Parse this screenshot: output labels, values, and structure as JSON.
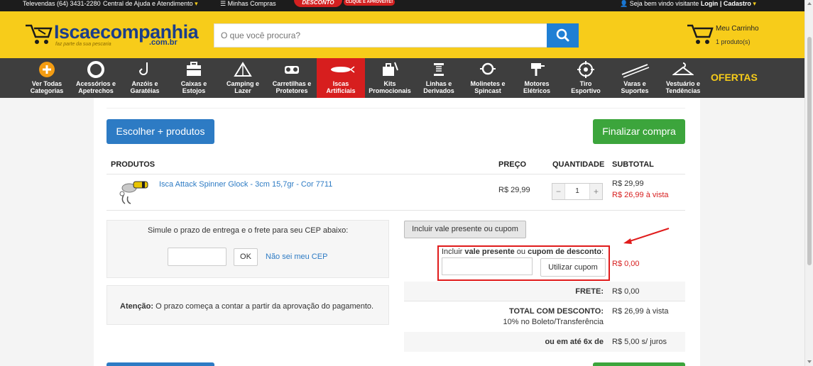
{
  "topbar": {
    "phone": "Televendas (64) 3431-2280",
    "help": "Central de Ajuda e Atendimento",
    "purchases": "Minhas Compras",
    "promo_discount": "DESCONTO",
    "promo_cta": "CLIQUE E APROVEITE!",
    "welcome": "Seja bem vindo visitante",
    "login": "Login",
    "separator": "|",
    "register": "Cadastro"
  },
  "header": {
    "logo_name": "Iscaecompanhia",
    "logo_domain": ".com.br",
    "logo_slogan": "faz parte da sua pescaria",
    "search_placeholder": "O que você procura?",
    "cart_title": "Meu Carrinho",
    "cart_count": "1 produto(s)"
  },
  "nav": {
    "items": [
      {
        "line1": "Ver Todas",
        "line2": "Categorias",
        "icon": "plus-circle-icon"
      },
      {
        "line1": "Acessórios e",
        "line2": "Apetrechos",
        "icon": "lifebuoy-icon"
      },
      {
        "line1": "Anzóis e",
        "line2": "Garatéias",
        "icon": "hook-icon"
      },
      {
        "line1": "Caixas e",
        "line2": "Estojos",
        "icon": "tackle-box-icon"
      },
      {
        "line1": "Camping e",
        "line2": "Lazer",
        "icon": "tent-icon"
      },
      {
        "line1": "Carretilhas e",
        "line2": "Protetores",
        "icon": "reel-icon"
      },
      {
        "line1": "Iscas",
        "line2": "Artificiais",
        "icon": "lure-icon"
      },
      {
        "line1": "Kits",
        "line2": "Promocionais",
        "icon": "kit-icon"
      },
      {
        "line1": "Linhas e",
        "line2": "Derivados",
        "icon": "spool-icon"
      },
      {
        "line1": "Molinetes e",
        "line2": "Spincast",
        "icon": "spinning-reel-icon"
      },
      {
        "line1": "Motores",
        "line2": "Elétricos",
        "icon": "motor-icon"
      },
      {
        "line1": "Tiro",
        "line2": "Esportivo",
        "icon": "target-icon"
      },
      {
        "line1": "Varas e",
        "line2": "Suportes",
        "icon": "rod-icon"
      },
      {
        "line1": "Vestuário e",
        "line2": "Tendências",
        "icon": "hanger-icon"
      }
    ],
    "offers": "OFERTAS"
  },
  "cart": {
    "continue_button": "Escolher + produtos",
    "checkout_button": "Finalizar compra",
    "headers": {
      "products": "PRODUTOS",
      "price": "PREÇO",
      "quantity": "QUANTIDADE",
      "subtotal": "SUBTOTAL"
    },
    "items": [
      {
        "name": "Isca Attack Spinner Glock - 3cm 15,7gr - Cor 7711",
        "price": "R$ 29,99",
        "quantity": "1",
        "subtotal": "R$ 29,99",
        "subtotal_cash": "R$ 26,99 à vista"
      }
    ]
  },
  "shipping": {
    "label": "Simule o prazo de entrega e o frete para seu CEP abaixo:",
    "ok_button": "OK",
    "unknown_cep_link": "Não sei meu CEP",
    "warning_bold": "Atenção:",
    "warning_text": " O prazo começa a contar a partir da aprovação do pagamento."
  },
  "coupon": {
    "toggle_button": "Incluir vale presente ou cupom",
    "label_prefix": "Incluir ",
    "label_gift": "vale presente",
    "label_or": " ou ",
    "label_coupon": "cupom de desconto",
    "label_colon": ":",
    "apply_button": "Utilizar cupom",
    "value": "R$ 0,00"
  },
  "totals": {
    "shipping_label": "FRETE:",
    "shipping_value": "R$ 0,00",
    "total_label": "TOTAL COM DESCONTO:",
    "total_sub": "10% no Boleto/Transferência",
    "total_value": "R$ 26,99 à vista",
    "installments_label": "ou em até 6x de",
    "installments_value": "R$ 5,00 s/ juros"
  },
  "colors": {
    "header_yellow": "#f7cc1a",
    "nav_dark": "#3e3e3e",
    "active_red": "#d71e1e",
    "primary_blue": "#2d7bc4",
    "success_green": "#3ca53c"
  }
}
